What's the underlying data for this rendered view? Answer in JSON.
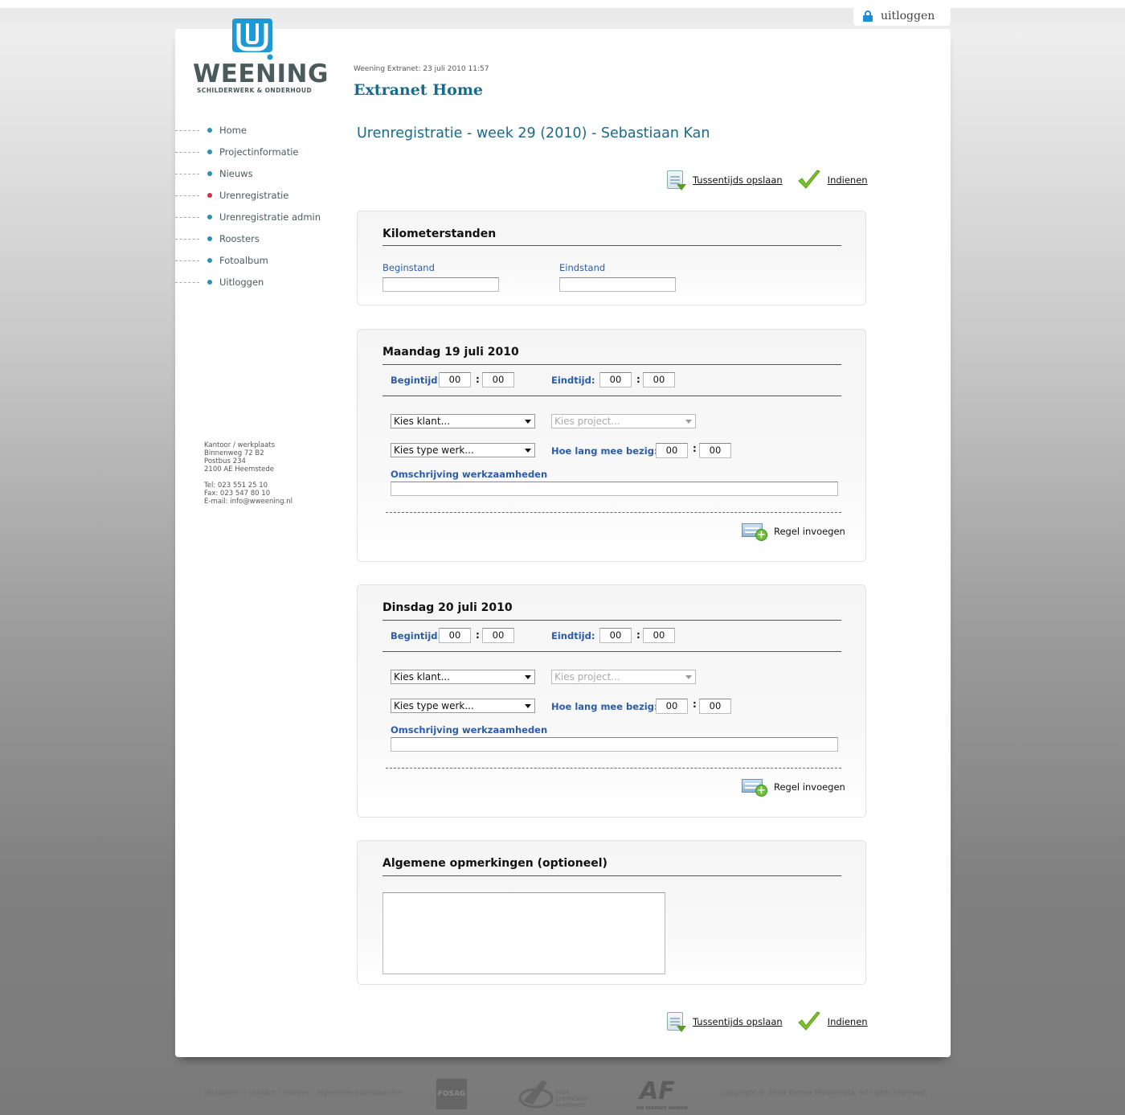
{
  "topbar": {
    "logout_label": "uitloggen"
  },
  "brand": {
    "name": "WEENING",
    "tagline": "SCHILDERWERK & ONDERHOUD"
  },
  "header": {
    "meta": "Weening Extranet: 23 juli 2010 11:57",
    "title": "Extranet Home"
  },
  "nav": {
    "items": [
      {
        "label": "Home",
        "active": false
      },
      {
        "label": "Projectinformatie",
        "active": false
      },
      {
        "label": "Nieuws",
        "active": false
      },
      {
        "label": "Urenregistratie",
        "active": true
      },
      {
        "label": "Urenregistratie admin",
        "active": false
      },
      {
        "label": "Roosters",
        "active": false
      },
      {
        "label": "Fotoalbum",
        "active": false
      },
      {
        "label": "Uitloggen",
        "active": false
      }
    ]
  },
  "address": {
    "lines": [
      "Kantoor / werkplaats",
      "Binnenweg 72 B2",
      "Postbus 234",
      "2100 AE Heemstede"
    ],
    "contact": [
      "Tel: 023 551 25 10",
      "Fax: 023 547 80 10",
      "E-mail: info@wweening.nl"
    ]
  },
  "page": {
    "heading": "Urenregistratie - week 29 (2010) - Sebastiaan Kan"
  },
  "actions": {
    "save_label": "Tussentijds opslaan",
    "submit_label": "Indienen"
  },
  "kilometers": {
    "title": "Kilometerstanden",
    "start_label": "Beginstand",
    "end_label": "Eindstand",
    "start_value": "",
    "end_value": ""
  },
  "days": [
    {
      "title": "Maandag 19 juli 2010",
      "start_label": "Begintijd:",
      "start_h": "00",
      "start_m": "00",
      "end_label": "Eindtijd:",
      "end_h": "00",
      "end_m": "00",
      "client_select": "Kies klant...",
      "project_select": "Kies project...",
      "worktype_select": "Kies type werk...",
      "duration_label": "Hoe lang mee bezig:",
      "duration_h": "00",
      "duration_m": "00",
      "description_label": "Omschrijving werkzaamheden",
      "description_value": "",
      "add_row_label": "Regel invoegen"
    },
    {
      "title": "Dinsdag 20 juli 2010",
      "start_label": "Begintijd:",
      "start_h": "00",
      "start_m": "00",
      "end_label": "Eindtijd:",
      "end_h": "00",
      "end_m": "00",
      "client_select": "Kies klant...",
      "project_select": "Kies project...",
      "worktype_select": "Kies type werk...",
      "duration_label": "Hoe lang mee bezig:",
      "duration_h": "00",
      "duration_m": "00",
      "description_label": "Omschrijving werkzaamheden",
      "description_value": "",
      "add_row_label": "Regel invoegen"
    }
  ],
  "remarks": {
    "title": "Algemene opmerkingen (optioneel)",
    "value": ""
  },
  "footer": {
    "links": "disclaimer - contact - relaties - algemene voorwaarden",
    "copyright": "Copyright © 2010 Extrea Multimedia. All rights reserved.",
    "logo_fosag": "FOSAG",
    "logo_vca_lines": [
      "VOOR",
      "CERTIFICEERT",
      "AANNEMERS"
    ],
    "logo_af": "AF",
    "logo_af_sub": "UW ERKENDE VAKMAN"
  },
  "colors": {
    "accent": "#1a6a8a",
    "label_blue": "#2a5ca8",
    "nav_dot": "#2e8fb8",
    "nav_active": "#d0314a",
    "check_green": "#7cc427"
  }
}
